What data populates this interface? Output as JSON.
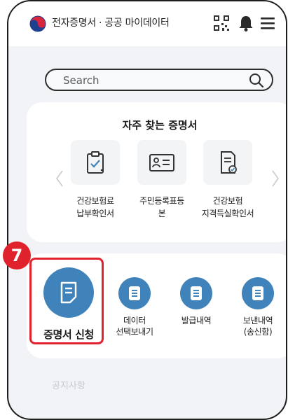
{
  "header": {
    "app_title": "전자증명서 · 공공 마이데이터",
    "icons": [
      "logo-icon",
      "qr-code-icon",
      "bell-icon",
      "hamburger-menu-icon"
    ]
  },
  "search": {
    "placeholder": "Search"
  },
  "frequent_certificates": {
    "title": "자주 찾는 증명서",
    "items": [
      {
        "label": "건강보험료\n납부확인서",
        "icon": "clipboard-check-icon"
      },
      {
        "label": "주민등록표등\n본",
        "icon": "id-card-icon"
      },
      {
        "label": "건강보험\n지격득실확인서",
        "icon": "document-check-icon"
      }
    ]
  },
  "actions": {
    "step_badge": "7",
    "items": [
      {
        "label": "증명서 신청",
        "icon": "document-edit-icon"
      },
      {
        "label": "데이터\n선택보내기",
        "icon": "document-icon"
      },
      {
        "label": "발급내역",
        "icon": "document-list-icon"
      },
      {
        "label": "보낸내역\n(송신함)",
        "icon": "document-sent-icon"
      }
    ]
  },
  "next_section_title": "공지사항",
  "colors": {
    "accent": "#3f83ba",
    "highlight": "#e0222d",
    "background": "#f1f3f7"
  }
}
